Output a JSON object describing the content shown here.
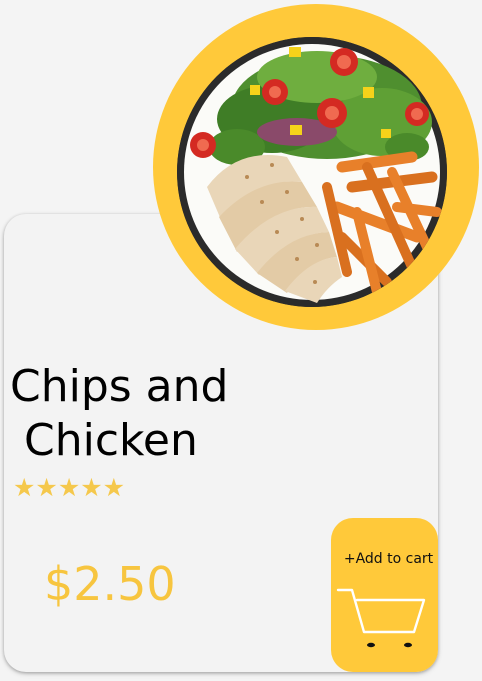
{
  "product": {
    "name": "Chips and\n Chicken",
    "rating_stars": "★★★★★",
    "rating_value": 5,
    "rating_max": 5,
    "price": "$2.50"
  },
  "cart_button": {
    "label": "+Add to cart"
  },
  "icons": {
    "cart": "shopping-cart-icon",
    "star": "star-icon"
  },
  "colors": {
    "accent": "#ffc93a",
    "price": "#f7c53f",
    "stars": "#f5c84c",
    "card": "#f3f3f3"
  }
}
